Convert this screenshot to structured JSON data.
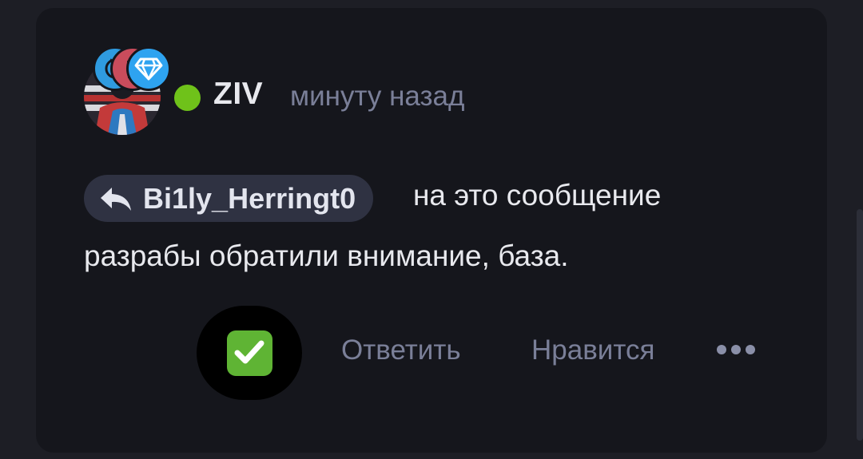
{
  "comment": {
    "author": {
      "name": "ZIV",
      "online": true,
      "avatar": "avatar-image",
      "badges": [
        "cat-badge-icon",
        "trophy-badge-icon",
        "diamond-badge-icon"
      ]
    },
    "timestamp": "минуту назад",
    "reply_to": {
      "icon": "reply-arrow-icon",
      "username": "Bi1ly_Herringt0",
      "suffix": "на это сообщение"
    },
    "text": "разрабы обратили внимание, база.",
    "reaction": {
      "icon": "check-mark-button-emoji",
      "label": "✅"
    },
    "actions": {
      "reply_label": "Ответить",
      "like_label": "Нравится",
      "more_icon": "more-dots-icon"
    }
  },
  "colors": {
    "background": "#1d1e25",
    "card": "#15161c",
    "online": "#6fc21a",
    "muted_text": "#7a7f98",
    "chip": "#2f3242",
    "check": "#5fb434"
  }
}
